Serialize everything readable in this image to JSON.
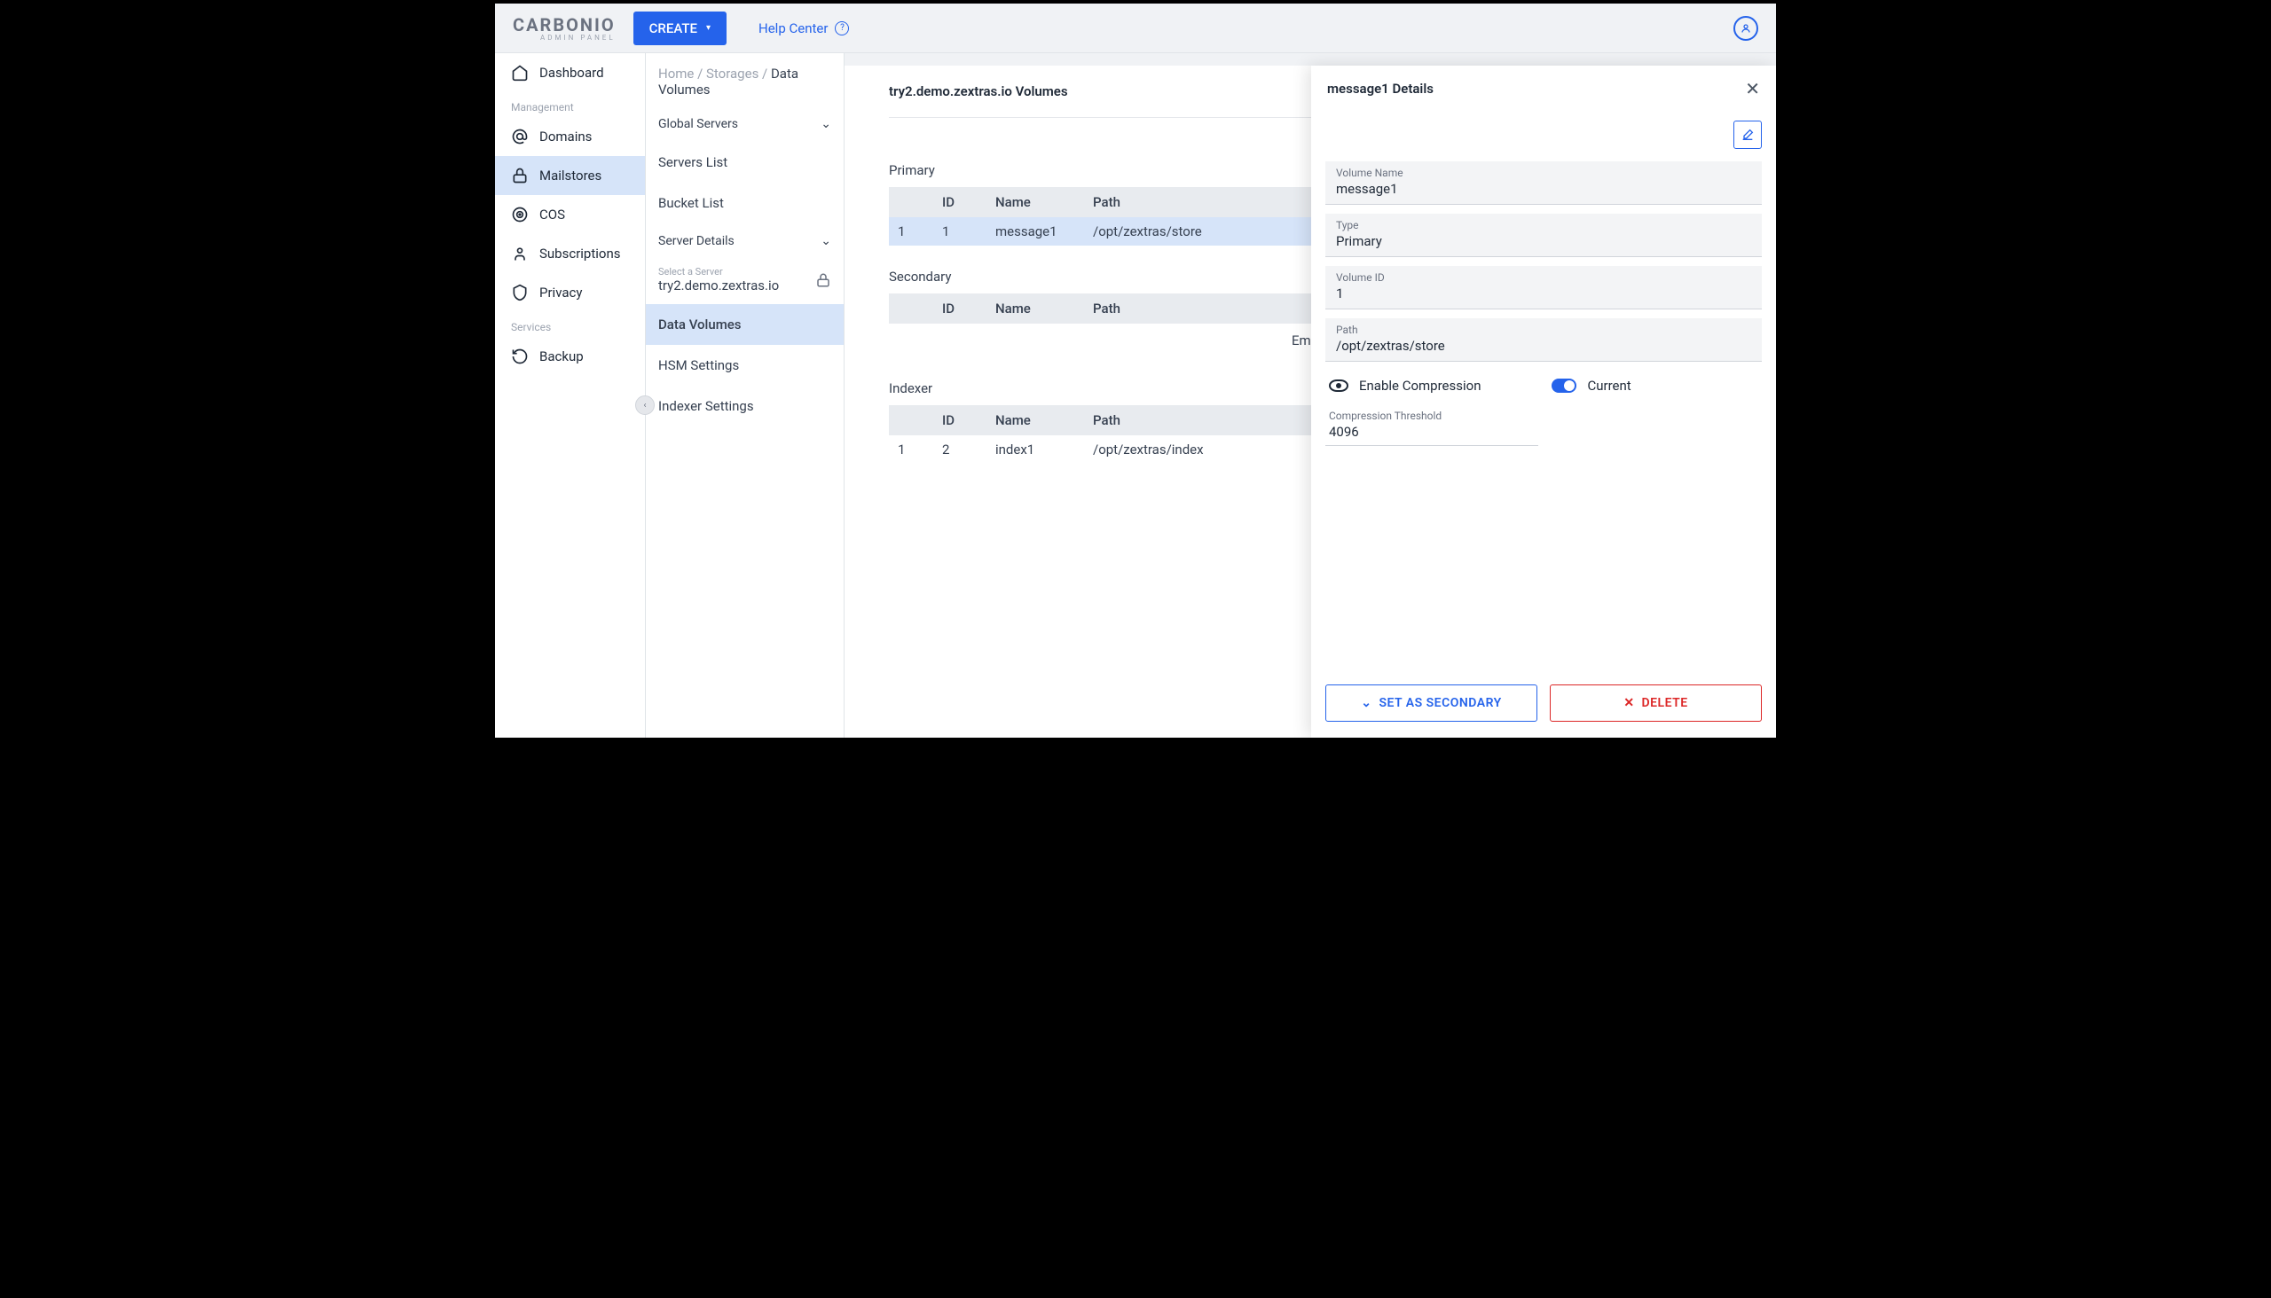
{
  "brand": {
    "name": "CARBONIO",
    "subtitle": "ADMIN PANEL"
  },
  "header": {
    "create": "CREATE",
    "help": "Help Center"
  },
  "sidebar": {
    "items": [
      {
        "label": "Dashboard",
        "icon": "home"
      }
    ],
    "management_label": "Management",
    "management": [
      {
        "label": "Domains",
        "icon": "at"
      },
      {
        "label": "Mailstores",
        "icon": "lock",
        "active": true
      },
      {
        "label": "COS",
        "icon": "target"
      },
      {
        "label": "Subscriptions",
        "icon": "person"
      },
      {
        "label": "Privacy",
        "icon": "shield"
      }
    ],
    "services_label": "Services",
    "services": [
      {
        "label": "Backup",
        "icon": "undo"
      }
    ]
  },
  "breadcrumb": {
    "home": "Home",
    "storages": "Storages",
    "current": "Data Volumes"
  },
  "sidebar2": {
    "global": "Global Servers",
    "servers_list": "Servers List",
    "bucket_list": "Bucket List",
    "server_details": "Server Details",
    "select_server_label": "Select a Server",
    "selected_server": "try2.demo.zextras.io",
    "data_volumes": "Data Volumes",
    "hsm": "HSM Settings",
    "indexer": "Indexer Settings"
  },
  "volumes": {
    "title": "try2.demo.zextras.io Volumes",
    "primary_label": "Primary",
    "secondary_label": "Secondary",
    "indexer_label": "Indexer",
    "headers": {
      "idx": "",
      "id": "ID",
      "name": "Name",
      "path": "Path"
    },
    "primary": [
      {
        "idx": "1",
        "id": "1",
        "name": "message1",
        "path": "/opt/zextras/store"
      }
    ],
    "secondary_empty": "Empty",
    "indexer": [
      {
        "idx": "1",
        "id": "2",
        "name": "index1",
        "path": "/opt/zextras/index"
      }
    ]
  },
  "details": {
    "title": "message1 Details",
    "volume_name_label": "Volume Name",
    "volume_name": "message1",
    "type_label": "Type",
    "type": "Primary",
    "volume_id_label": "Volume ID",
    "volume_id": "1",
    "path_label": "Path",
    "path": "/opt/zextras/store",
    "enable_compression": "Enable Compression",
    "current": "Current",
    "threshold_label": "Compression Threshold",
    "threshold": "4096",
    "set_secondary": "SET AS SECONDARY",
    "delete": "DELETE"
  }
}
